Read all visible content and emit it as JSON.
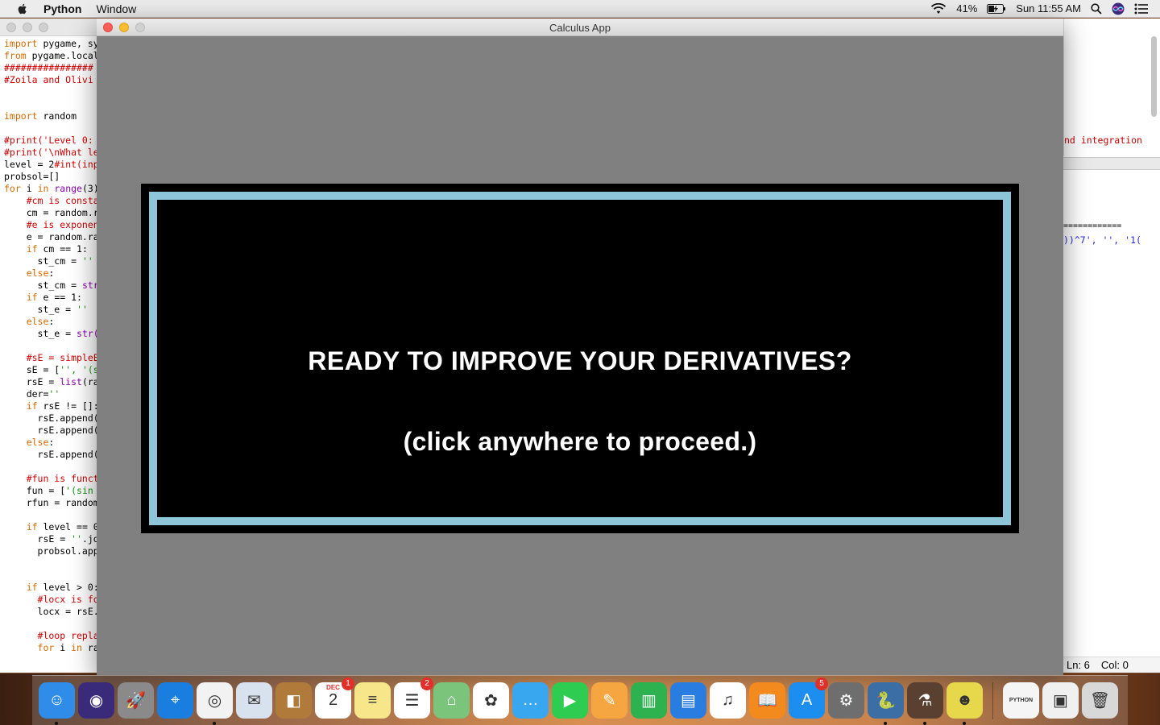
{
  "menubar": {
    "app_name": "Python",
    "window_menu": "Window",
    "battery": "41%",
    "clock": "Sun 11:55 AM"
  },
  "editor": {
    "code_lines": [
      {
        "segments": [
          {
            "t": "import",
            "c": "kw"
          },
          {
            "t": " pygame, sy",
            "c": ""
          }
        ]
      },
      {
        "segments": [
          {
            "t": "from",
            "c": "kw"
          },
          {
            "t": " pygame.local",
            "c": ""
          }
        ]
      },
      {
        "segments": [
          {
            "t": "################",
            "c": "cm"
          }
        ]
      },
      {
        "segments": [
          {
            "t": "#Zoila and Olivi",
            "c": "cm"
          }
        ]
      },
      {
        "segments": []
      },
      {
        "segments": []
      },
      {
        "segments": [
          {
            "t": "import",
            "c": "kw"
          },
          {
            "t": " random",
            "c": ""
          }
        ]
      },
      {
        "segments": []
      },
      {
        "segments": [
          {
            "t": "#print('Level 0:",
            "c": "cm"
          }
        ]
      },
      {
        "segments": [
          {
            "t": "#print('\\nWhat le",
            "c": "cm"
          }
        ]
      },
      {
        "segments": [
          {
            "t": "level = 2",
            "c": ""
          },
          {
            "t": "#int(inp",
            "c": "cm"
          }
        ]
      },
      {
        "segments": [
          {
            "t": "probsol=[]",
            "c": ""
          }
        ]
      },
      {
        "segments": [
          {
            "t": "for",
            "c": "kw"
          },
          {
            "t": " i ",
            "c": ""
          },
          {
            "t": "in",
            "c": "kw"
          },
          {
            "t": " ",
            "c": ""
          },
          {
            "t": "range",
            "c": "bi"
          },
          {
            "t": "(3)",
            "c": ""
          }
        ]
      },
      {
        "segments": [
          {
            "t": "    #cm is consta",
            "c": "cm"
          }
        ]
      },
      {
        "segments": [
          {
            "t": "    cm = random.r",
            "c": ""
          }
        ]
      },
      {
        "segments": [
          {
            "t": "    #e is exponen",
            "c": "cm"
          }
        ]
      },
      {
        "segments": [
          {
            "t": "    e = random.ra",
            "c": ""
          }
        ]
      },
      {
        "segments": [
          {
            "t": "    ",
            "c": ""
          },
          {
            "t": "if",
            "c": "kw"
          },
          {
            "t": " cm == 1:",
            "c": ""
          }
        ]
      },
      {
        "segments": [
          {
            "t": "      st_cm = ",
            "c": ""
          },
          {
            "t": "''",
            "c": "st"
          }
        ]
      },
      {
        "segments": [
          {
            "t": "    ",
            "c": ""
          },
          {
            "t": "else",
            "c": "kw"
          },
          {
            "t": ":",
            "c": ""
          }
        ]
      },
      {
        "segments": [
          {
            "t": "      st_cm = ",
            "c": ""
          },
          {
            "t": "str",
            "c": "bi"
          }
        ]
      },
      {
        "segments": [
          {
            "t": "    ",
            "c": ""
          },
          {
            "t": "if",
            "c": "kw"
          },
          {
            "t": " e == 1:",
            "c": ""
          }
        ]
      },
      {
        "segments": [
          {
            "t": "      st_e = ",
            "c": ""
          },
          {
            "t": "''",
            "c": "st"
          }
        ]
      },
      {
        "segments": [
          {
            "t": "    ",
            "c": ""
          },
          {
            "t": "else",
            "c": "kw"
          },
          {
            "t": ":",
            "c": ""
          }
        ]
      },
      {
        "segments": [
          {
            "t": "      st_e = ",
            "c": ""
          },
          {
            "t": "str(",
            "c": "bi"
          }
        ]
      },
      {
        "segments": []
      },
      {
        "segments": [
          {
            "t": "    #sE = simpleE",
            "c": "cm"
          }
        ]
      },
      {
        "segments": [
          {
            "t": "    sE = [",
            "c": ""
          },
          {
            "t": "'', '(s",
            "c": "st"
          }
        ]
      },
      {
        "segments": [
          {
            "t": "    rsE = ",
            "c": ""
          },
          {
            "t": "list",
            "c": "bi"
          },
          {
            "t": "(ra",
            "c": ""
          }
        ]
      },
      {
        "segments": [
          {
            "t": "    der=",
            "c": ""
          },
          {
            "t": "''",
            "c": "st"
          }
        ]
      },
      {
        "segments": [
          {
            "t": "    ",
            "c": ""
          },
          {
            "t": "if",
            "c": "kw"
          },
          {
            "t": " rsE != []:",
            "c": ""
          }
        ]
      },
      {
        "segments": [
          {
            "t": "      rsE.append(",
            "c": ""
          }
        ]
      },
      {
        "segments": [
          {
            "t": "      rsE.append(",
            "c": ""
          }
        ]
      },
      {
        "segments": [
          {
            "t": "    ",
            "c": ""
          },
          {
            "t": "else",
            "c": "kw"
          },
          {
            "t": ":",
            "c": ""
          }
        ]
      },
      {
        "segments": [
          {
            "t": "      rsE.append(",
            "c": ""
          }
        ]
      },
      {
        "segments": []
      },
      {
        "segments": [
          {
            "t": "    #fun is funct",
            "c": "cm"
          }
        ]
      },
      {
        "segments": [
          {
            "t": "    fun = [",
            "c": ""
          },
          {
            "t": "'(sin",
            "c": "st"
          }
        ]
      },
      {
        "segments": [
          {
            "t": "    rfun = random",
            "c": ""
          }
        ]
      },
      {
        "segments": []
      },
      {
        "segments": [
          {
            "t": "    ",
            "c": ""
          },
          {
            "t": "if",
            "c": "kw"
          },
          {
            "t": " level == 0",
            "c": ""
          }
        ]
      },
      {
        "segments": [
          {
            "t": "      rsE = ",
            "c": ""
          },
          {
            "t": "''",
            "c": "st"
          },
          {
            "t": ".jo",
            "c": ""
          }
        ]
      },
      {
        "segments": [
          {
            "t": "      probsol.app",
            "c": ""
          }
        ]
      },
      {
        "segments": []
      },
      {
        "segments": []
      },
      {
        "segments": [
          {
            "t": "    ",
            "c": ""
          },
          {
            "t": "if",
            "c": "kw"
          },
          {
            "t": " level > 0:",
            "c": ""
          }
        ]
      },
      {
        "segments": [
          {
            "t": "      #locx is fo",
            "c": "cm"
          }
        ]
      },
      {
        "segments": [
          {
            "t": "      locx = rsE.",
            "c": ""
          }
        ]
      },
      {
        "segments": []
      },
      {
        "segments": [
          {
            "t": "      #loop repla",
            "c": "cm"
          }
        ]
      },
      {
        "segments": [
          {
            "t": "      ",
            "c": ""
          },
          {
            "t": "for",
            "c": "kw"
          },
          {
            "t": " i ",
            "c": ""
          },
          {
            "t": "in",
            "c": "kw"
          },
          {
            "t": " ra",
            "c": ""
          }
        ]
      }
    ],
    "right_integration": "nd integration",
    "right_eq": "============",
    "right_str": "))^7', '', '1(",
    "status_ln": "Ln: 6",
    "status_col": "Col: 0"
  },
  "app": {
    "title": "Calculus App",
    "headline": "READY TO IMPROVE YOUR DERIVATIVES?",
    "subline": "(click anywhere to proceed.)",
    "frame_color": "#8ec5d8"
  },
  "dock": {
    "items": [
      {
        "name": "finder-icon",
        "bg": "#2f8ce8",
        "glyph": "☺",
        "running": true,
        "badge": null
      },
      {
        "name": "siri-icon",
        "bg": "#3a2a7a",
        "glyph": "◉",
        "running": false,
        "badge": null
      },
      {
        "name": "launchpad-icon",
        "bg": "#8a8a8a",
        "glyph": "🚀",
        "running": false,
        "badge": null
      },
      {
        "name": "safari-icon",
        "bg": "#1a7ee0",
        "glyph": "⌖",
        "running": false,
        "badge": null
      },
      {
        "name": "chrome-icon",
        "bg": "#f2f2f2",
        "glyph": "◎",
        "running": true,
        "badge": null
      },
      {
        "name": "mail-icon",
        "bg": "#d8e2ee",
        "glyph": "✉",
        "running": false,
        "badge": null
      },
      {
        "name": "contacts-icon",
        "bg": "#b07a3a",
        "glyph": "◧",
        "running": false,
        "badge": null
      },
      {
        "name": "calendar-icon",
        "bg": "#ffffff",
        "glyph": "2",
        "running": false,
        "badge": "1",
        "label": "DEC"
      },
      {
        "name": "notes-icon",
        "bg": "#f7e68a",
        "glyph": "≡",
        "running": false,
        "badge": null
      },
      {
        "name": "reminders-icon",
        "bg": "#ffffff",
        "glyph": "☰",
        "running": false,
        "badge": "2"
      },
      {
        "name": "maps-icon",
        "bg": "#7bc47b",
        "glyph": "⌂",
        "running": false,
        "badge": null
      },
      {
        "name": "photos-icon",
        "bg": "#ffffff",
        "glyph": "✿",
        "running": false,
        "badge": null
      },
      {
        "name": "messages-icon",
        "bg": "#39a7f0",
        "glyph": "…",
        "running": false,
        "badge": null
      },
      {
        "name": "facetime-icon",
        "bg": "#2ecc50",
        "glyph": "▶",
        "running": false,
        "badge": null
      },
      {
        "name": "pages-icon",
        "bg": "#f6a640",
        "glyph": "✎",
        "running": false,
        "badge": null
      },
      {
        "name": "numbers-icon",
        "bg": "#2db24f",
        "glyph": "▥",
        "running": false,
        "badge": null
      },
      {
        "name": "keynote-icon",
        "bg": "#2a7de0",
        "glyph": "▤",
        "running": false,
        "badge": null
      },
      {
        "name": "itunes-icon",
        "bg": "#ffffff",
        "glyph": "♫",
        "running": false,
        "badge": null
      },
      {
        "name": "ibooks-icon",
        "bg": "#f28a1e",
        "glyph": "📖",
        "running": false,
        "badge": null
      },
      {
        "name": "app-store-icon",
        "bg": "#1c8ef0",
        "glyph": "A",
        "running": false,
        "badge": "5"
      },
      {
        "name": "system-preferences-icon",
        "bg": "#6e6e6e",
        "glyph": "⚙",
        "running": false,
        "badge": null
      },
      {
        "name": "python-launcher-icon",
        "bg": "#3a6ea5",
        "glyph": "🐍",
        "running": true,
        "badge": null
      },
      {
        "name": "python-app-icon",
        "bg": "#5a4030",
        "glyph": "⚗",
        "running": true,
        "badge": null
      },
      {
        "name": "pygame-icon",
        "bg": "#e6d84a",
        "glyph": "☻",
        "running": true,
        "badge": null
      }
    ],
    "right_items": [
      {
        "name": "python-document-icon",
        "bg": "#f5f5f5",
        "glyph": "PYTHON"
      },
      {
        "name": "preview-document-icon",
        "bg": "#f0f0f0",
        "glyph": "▣"
      },
      {
        "name": "trash-icon",
        "bg": "#d8d8d8",
        "glyph": "🗑"
      }
    ]
  }
}
